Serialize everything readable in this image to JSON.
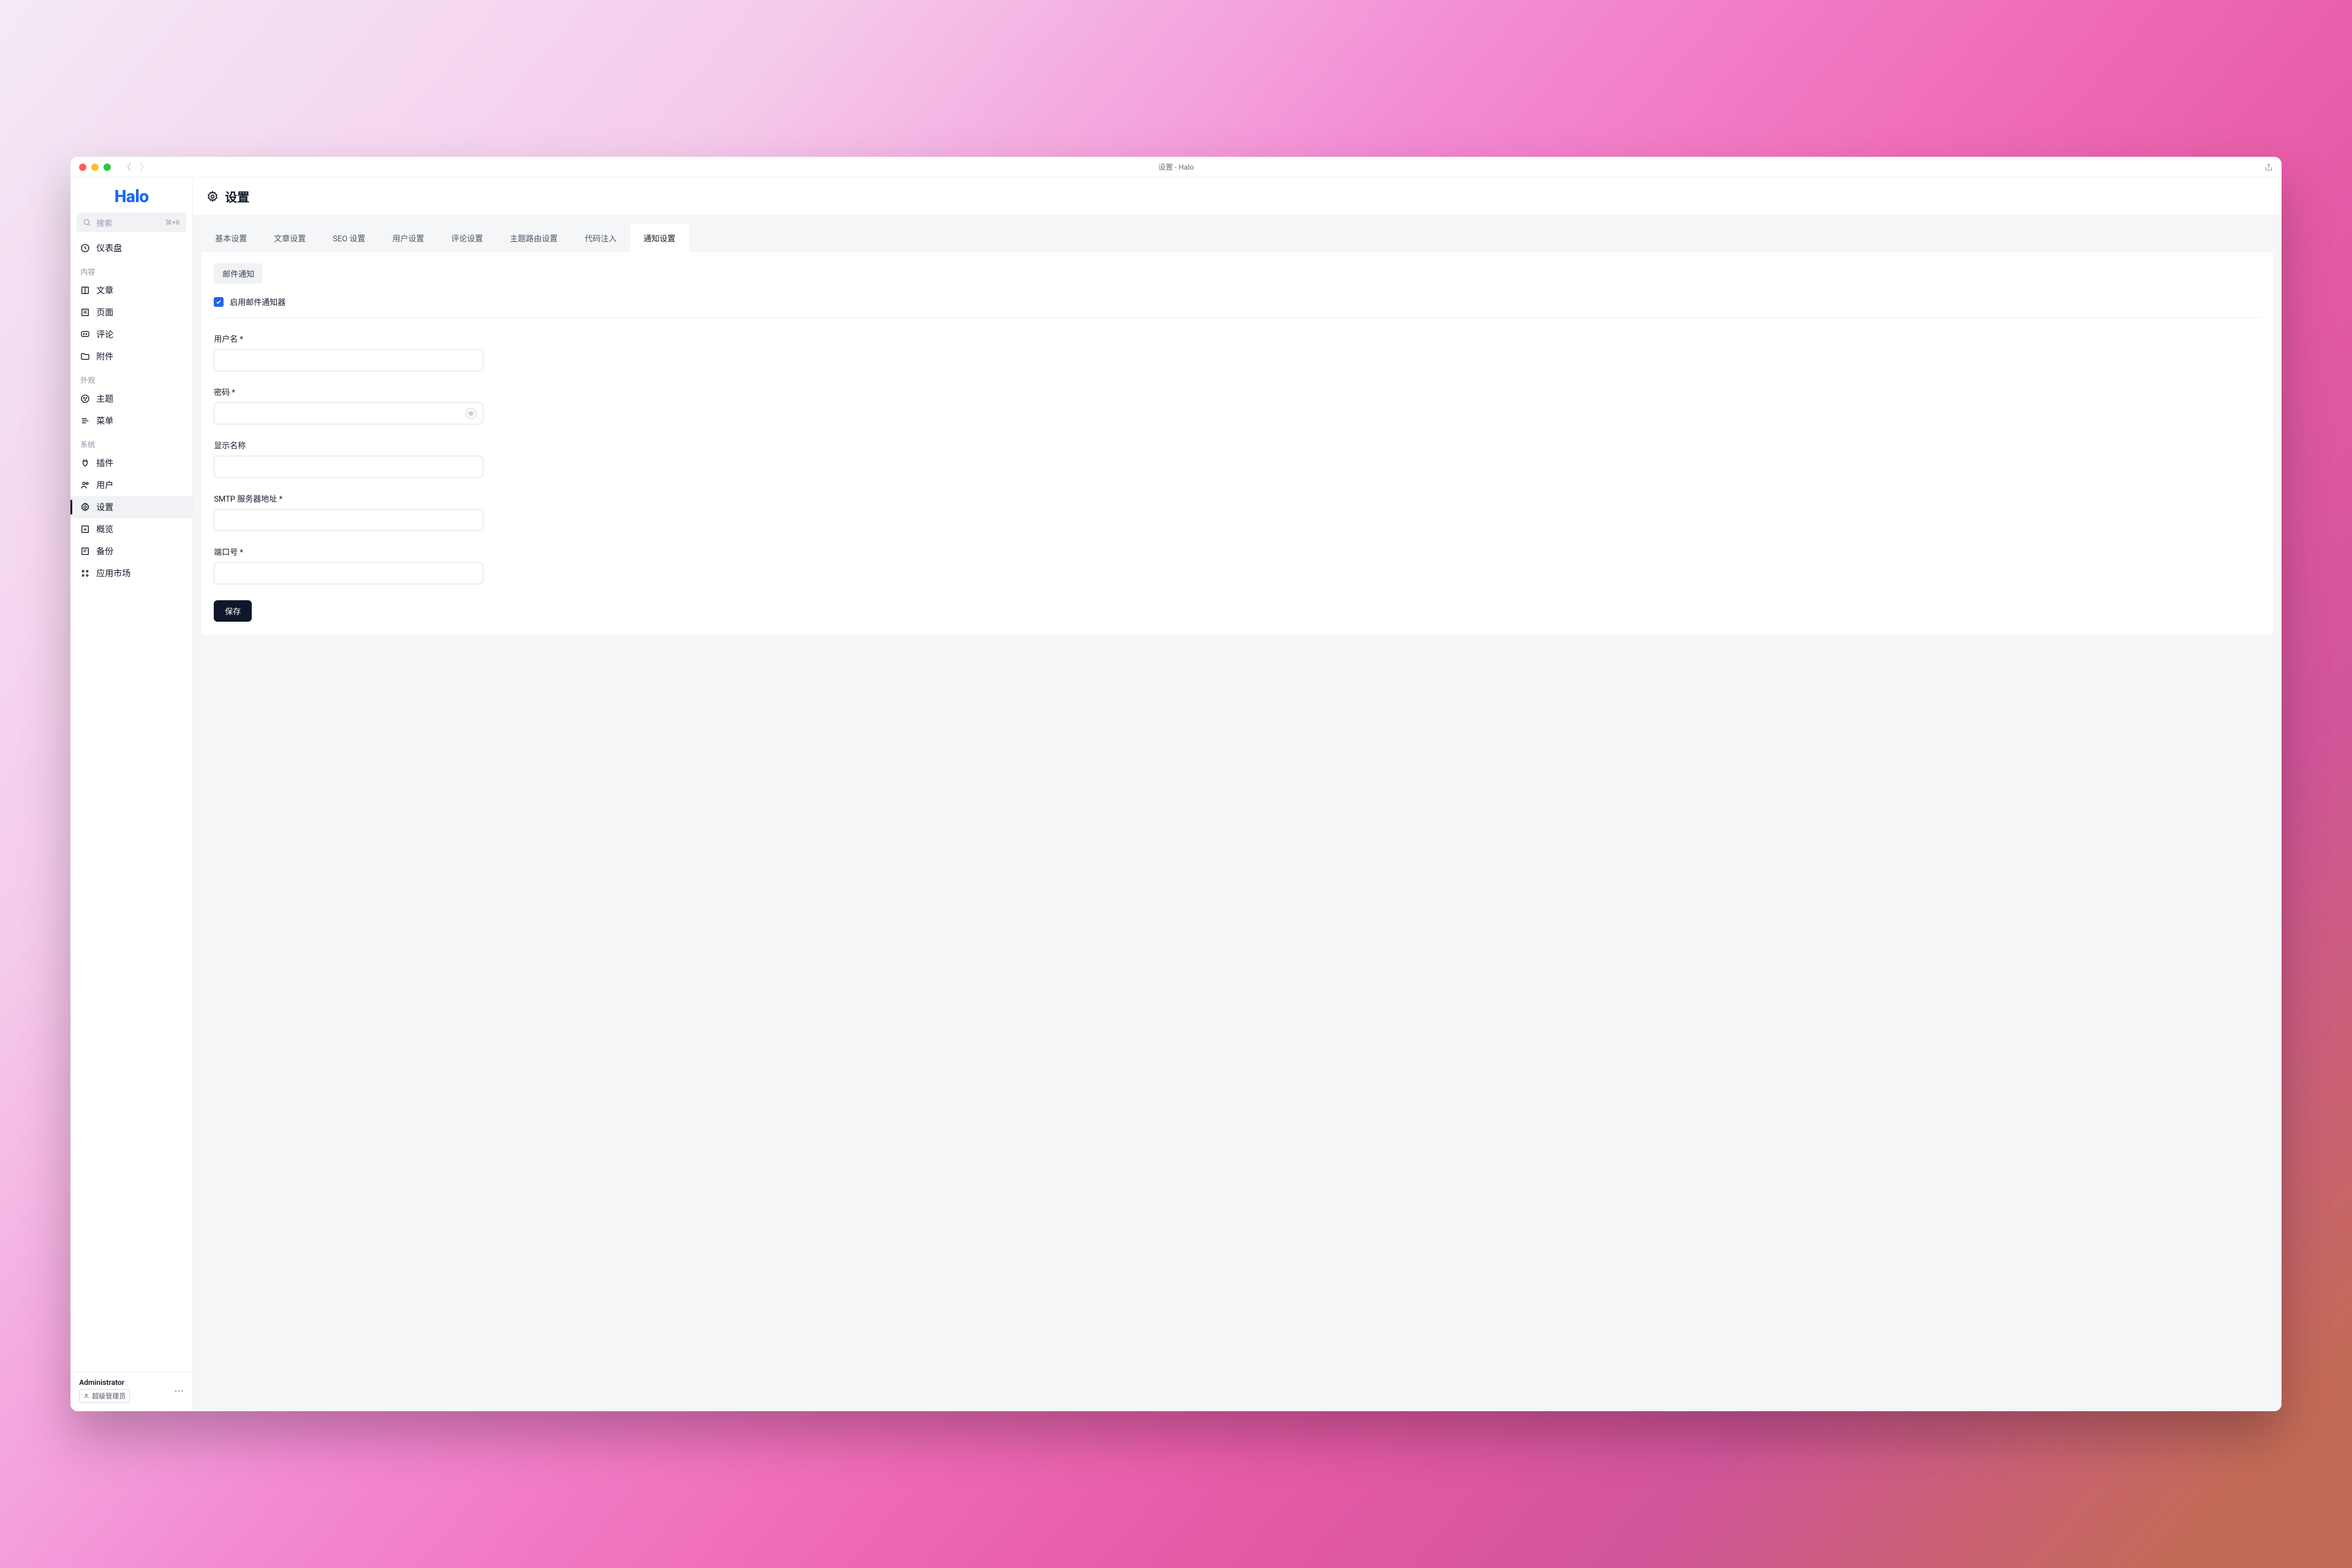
{
  "window": {
    "title": "设置 - Halo"
  },
  "brand": "Halo",
  "search": {
    "placeholder": "搜索",
    "shortcut": "⌘+K"
  },
  "sidebar": {
    "top": {
      "label": "仪表盘"
    },
    "groups": [
      {
        "title": "内容",
        "items": [
          {
            "label": "文章"
          },
          {
            "label": "页面"
          },
          {
            "label": "评论"
          },
          {
            "label": "附件"
          }
        ]
      },
      {
        "title": "外观",
        "items": [
          {
            "label": "主题"
          },
          {
            "label": "菜单"
          }
        ]
      },
      {
        "title": "系统",
        "items": [
          {
            "label": "插件"
          },
          {
            "label": "用户"
          },
          {
            "label": "设置",
            "active": true
          },
          {
            "label": "概览"
          },
          {
            "label": "备份"
          },
          {
            "label": "应用市场"
          }
        ]
      }
    ]
  },
  "footer": {
    "name": "Administrator",
    "role": "超级管理员"
  },
  "page": {
    "title": "设置"
  },
  "tabs": [
    "基本设置",
    "文章设置",
    "SEO 设置",
    "用户设置",
    "评论设置",
    "主题路由设置",
    "代码注入",
    "通知设置"
  ],
  "active_tab_index": 7,
  "subtab": "邮件通知",
  "checkbox": {
    "label": "启用邮件通知器",
    "checked": true
  },
  "fields": {
    "username": {
      "label": "用户名 *",
      "value": ""
    },
    "password": {
      "label": "密码 *",
      "value": ""
    },
    "displayName": {
      "label": "显示名称",
      "value": ""
    },
    "smtp": {
      "label": "SMTP 服务器地址 *",
      "value": ""
    },
    "port": {
      "label": "端口号 *",
      "value": ""
    }
  },
  "save_label": "保存"
}
